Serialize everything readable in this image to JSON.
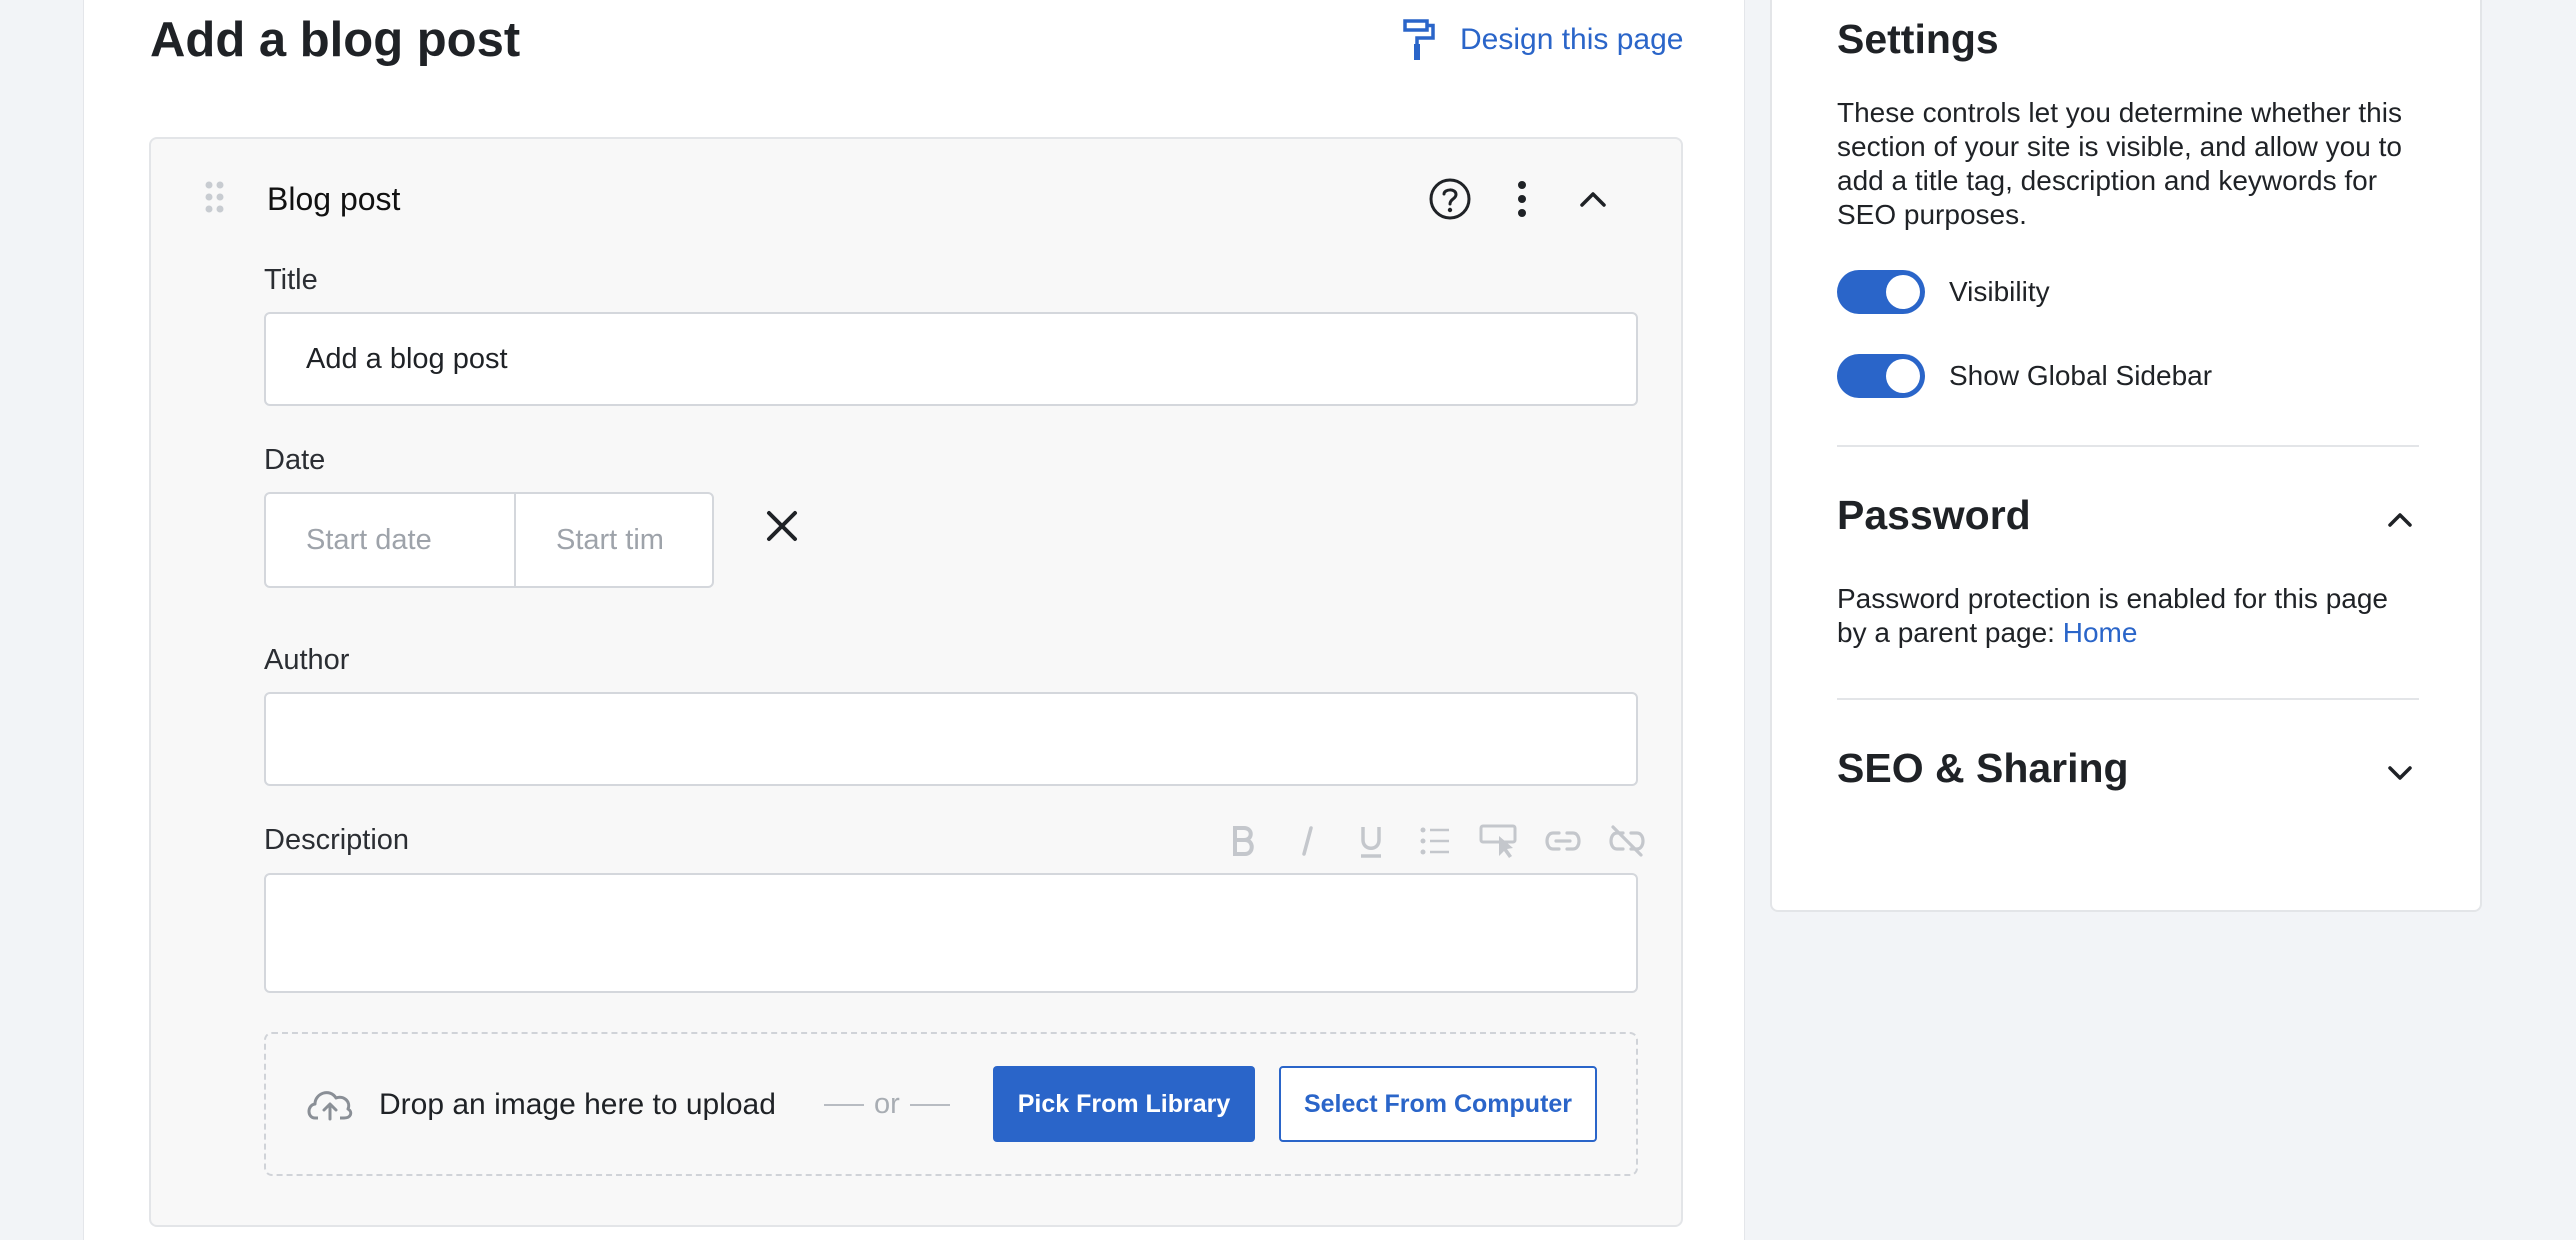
{
  "page": {
    "title": "Add a blog post",
    "design_link": "Design this page"
  },
  "block": {
    "name": "Blog post",
    "fields": {
      "title_label": "Title",
      "title_value": "Add a blog post",
      "date_label": "Date",
      "start_date_placeholder": "Start date",
      "start_time_placeholder": "Start tim",
      "author_label": "Author",
      "author_value": "",
      "description_label": "Description"
    },
    "upload": {
      "drop_text": "Drop an image here to upload",
      "or_text": "or",
      "pick_library": "Pick From Library",
      "select_computer": "Select From Computer"
    }
  },
  "settings": {
    "title": "Settings",
    "description": "These controls let you determine whether this section of your site is visible, and allow you to add a title tag, description and keywords for SEO purposes.",
    "toggles": [
      {
        "label": "Visibility",
        "on": true
      },
      {
        "label": "Show Global Sidebar",
        "on": true
      }
    ],
    "password": {
      "title": "Password",
      "text": "Password protection is enabled for this page by a parent page: ",
      "link": "Home"
    },
    "seo": {
      "title": "SEO & Sharing"
    }
  },
  "colors": {
    "accent": "#2a65c9",
    "background": "#f2f4f7"
  }
}
